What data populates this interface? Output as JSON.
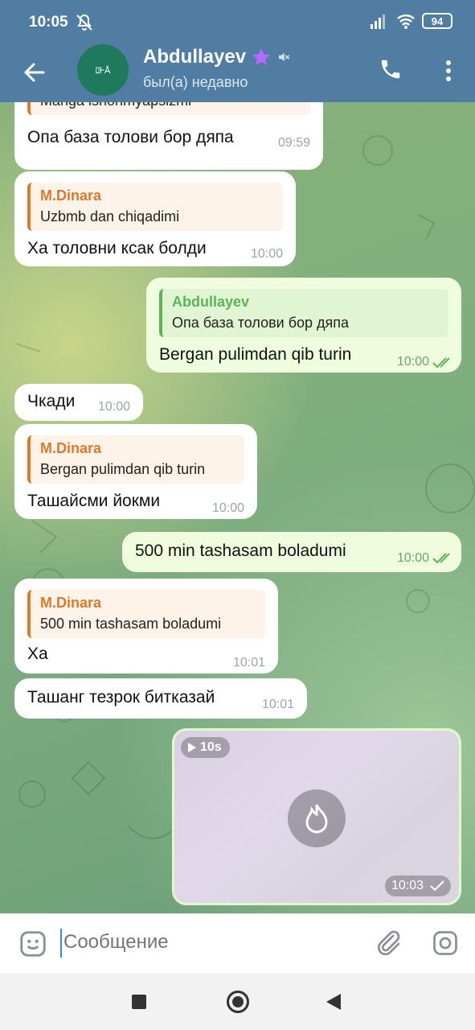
{
  "status": {
    "time": "10:05",
    "battery": "94"
  },
  "header": {
    "title": "Abdullayev",
    "subtitle": "был(а) недавно",
    "avatar_text": "ﾛᎰÅ"
  },
  "messages": [
    {
      "text": "Manga ishonmyapsizmi"
    },
    {
      "text": "Опа база толови бор дяпа",
      "time": "09:59"
    },
    {
      "reply_name": "M.Dinara",
      "reply_text": "Uzbmb dan chiqadimi",
      "text": "Ха толовни ксак болди",
      "time": "10:00"
    },
    {
      "reply_name": "Abdullayev",
      "reply_text": "Опа база толови бор дяпа",
      "text": "Bergan pulimdan qib turin",
      "time": "10:00"
    },
    {
      "text": "Чкади",
      "time": "10:00"
    },
    {
      "reply_name": "M.Dinara",
      "reply_text": "Bergan pulimdan qib turin",
      "text": "Ташайсми йокми",
      "time": "10:00"
    },
    {
      "text": "500 min tashasam boladumi",
      "time": "10:00"
    },
    {
      "reply_name": "M.Dinara",
      "reply_text": "500 min tashasam boladumi",
      "text": "Ха",
      "time": "10:01"
    },
    {
      "text": "Ташанг тезрок битказай",
      "time": "10:01"
    }
  ],
  "video": {
    "duration": "10s",
    "time": "10:03"
  },
  "input": {
    "placeholder": "Сообщение"
  },
  "colors": {
    "header": "#517da2",
    "incoming": "#ffffff",
    "outgoing": "#effdde",
    "accent": "#d97a2f",
    "outgoing_accent": "#5cb458"
  }
}
